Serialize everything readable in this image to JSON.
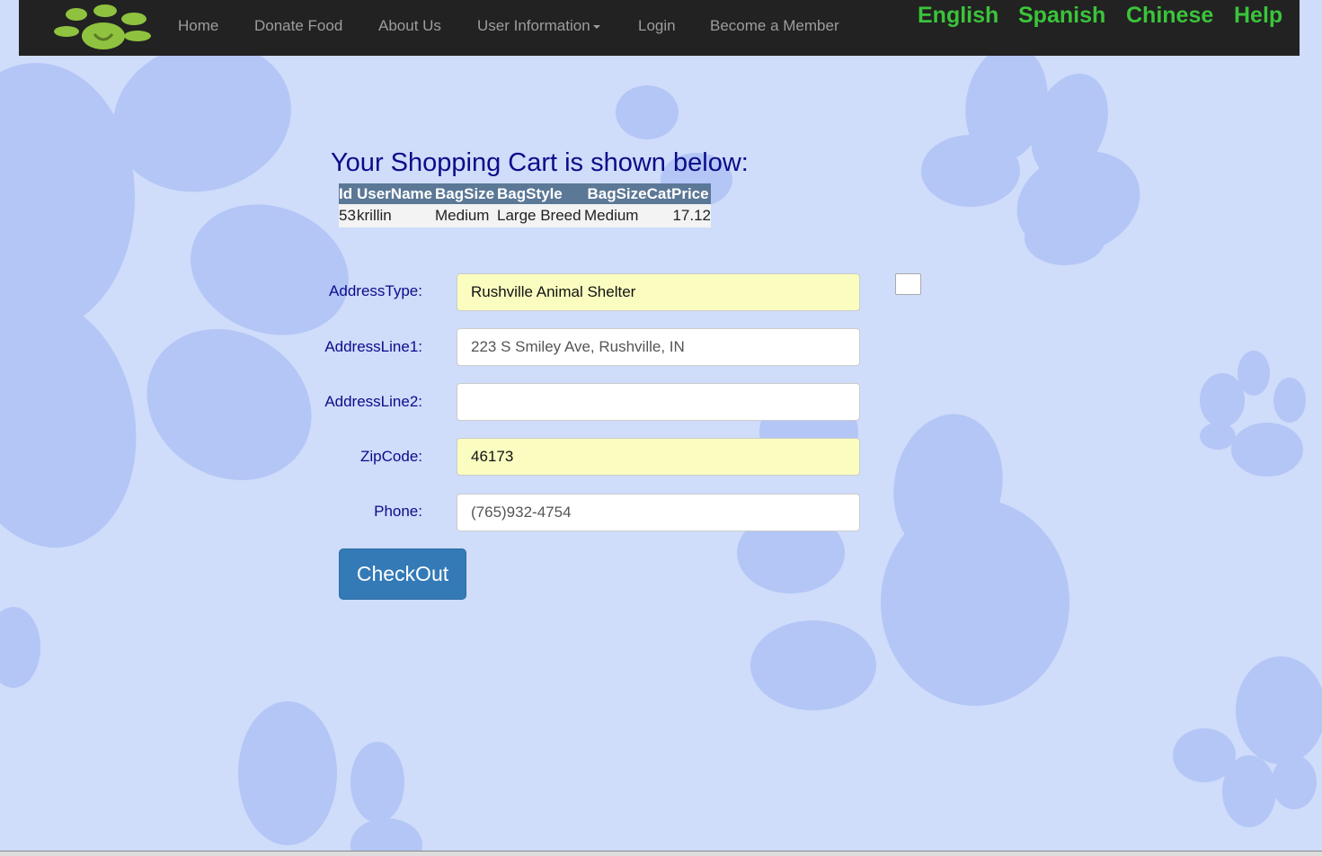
{
  "nav": {
    "logo_icon": "paw-heart-logo",
    "items": [
      "Home",
      "Donate Food",
      "About Us",
      "User Information",
      "Login",
      "Become a Member"
    ],
    "languages": [
      "English",
      "Spanish",
      "Chinese",
      "Help"
    ]
  },
  "cart": {
    "title": "Your Shopping Cart is shown below:",
    "columns": [
      "Id",
      "UserName",
      "BagSize",
      "BagStyle",
      "BagSizeCat",
      "Price"
    ],
    "rows": [
      [
        "53",
        "krillin",
        "Medium",
        "Large Breed",
        "Medium",
        "17.12"
      ]
    ]
  },
  "form": {
    "address_type_label": "AddressType:",
    "address_type_value": "Rushville Animal Shelter",
    "address_line1_label": "AddressLine1:",
    "address_line1_value": "223 S Smiley Ave, Rushville, IN",
    "address_line2_label": "AddressLine2:",
    "address_line2_value": "",
    "zip_label": "ZipCode:",
    "zip_value": "46173",
    "phone_label": "Phone:",
    "phone_value": "(765)932-4754",
    "checkout_label": "CheckOut"
  },
  "colors": {
    "background": "#cfdcfa",
    "paw": "#b3c6f6",
    "navbar": "#222222",
    "nav_text": "#9d9d9d",
    "language_links": "#3bc43b",
    "heading": "#0c0c8a",
    "table_header": "#5b7896",
    "autofill": "#fbfdc0",
    "button": "#337ab7"
  }
}
